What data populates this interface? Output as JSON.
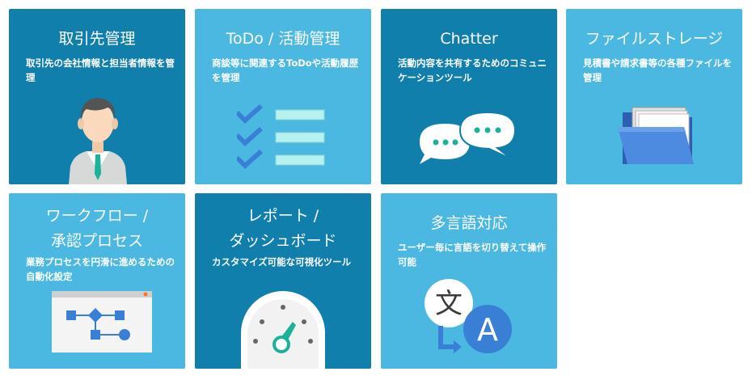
{
  "tiles": [
    {
      "title": "取引先管理",
      "desc": "取引先の会社情報と担当者情報を管理",
      "icon": "businessman-icon"
    },
    {
      "title": "ToDo / 活動管理",
      "desc": "商談等に関連するToDoや活動履歴を管理",
      "icon": "checklist-icon"
    },
    {
      "title": "Chatter",
      "desc": "活動内容を共有するためのコミュニケーションツール",
      "icon": "chat-bubbles-icon"
    },
    {
      "title": "ファイルストレージ",
      "desc": "見積書や請求書等の各種ファイルを管理",
      "icon": "folder-icon"
    },
    {
      "title_line1": "ワークフロー /",
      "title_line2": "承認プロセス",
      "desc": "業務プロセスを円滑に進めるための自動化設定",
      "icon": "workflow-icon"
    },
    {
      "title_line1": "レポート /",
      "title_line2": "ダッシュボード",
      "desc": "カスタマイズ可能な可視化ツール",
      "icon": "gauge-icon"
    },
    {
      "title": "多言語対応",
      "desc": "ユーザー毎に言語を切り替えて操作可能",
      "icon": "translate-icon"
    }
  ],
  "translate_glyphs": {
    "source": "文",
    "target": "A"
  },
  "colors": {
    "dark_tile": "#117fac",
    "light_tile": "#4ab8e1"
  }
}
